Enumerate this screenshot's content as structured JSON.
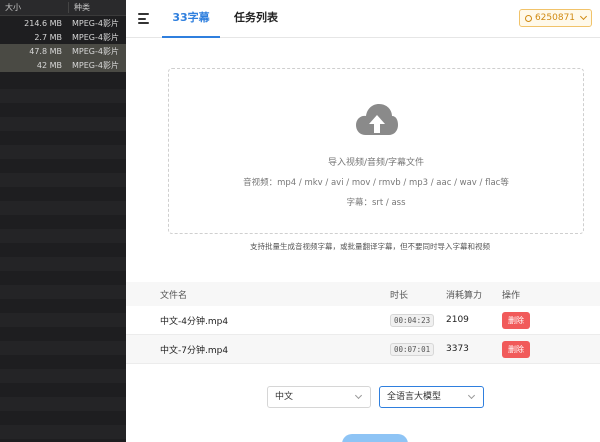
{
  "finder": {
    "header": {
      "size": "大小",
      "kind": "种类"
    },
    "rows": [
      {
        "size": "214.6 MB",
        "kind": "MPEG-4影片"
      },
      {
        "size": "2.7 MB",
        "kind": "MPEG-4影片"
      },
      {
        "size": "47.8 MB",
        "kind": "MPEG-4影片"
      },
      {
        "size": "42 MB",
        "kind": "MPEG-4影片"
      }
    ]
  },
  "header": {
    "tabs": [
      {
        "label": "33字幕",
        "active": true
      },
      {
        "label": "任务列表",
        "active": false
      }
    ],
    "account_id": "6250871"
  },
  "dropzone": {
    "title": "导入视频/音频/字幕文件",
    "video_formats": "音视频：mp4 / mkv / avi / mov / rmvb / mp3 / aac / wav / flac等",
    "subtitle_formats": "字幕：srt / ass",
    "hint": "支持批量生成音视频字幕，或批量翻译字幕，但不要同时导入字幕和视频"
  },
  "table": {
    "columns": {
      "name": "文件名",
      "duration": "时长",
      "cost": "消耗算力",
      "action": "操作"
    },
    "rows": [
      {
        "name": "中文-4分钟.mp4",
        "duration": "00:04:23",
        "cost": "2109",
        "action": "删除"
      },
      {
        "name": "中文-7分钟.mp4",
        "duration": "00:07:01",
        "cost": "3373",
        "action": "删除"
      }
    ]
  },
  "controls": {
    "language": "中文",
    "model": "全语言大模型"
  },
  "colors": {
    "accent": "#2f7fde",
    "danger": "#f15a5a",
    "account_border": "#f1c36a"
  }
}
